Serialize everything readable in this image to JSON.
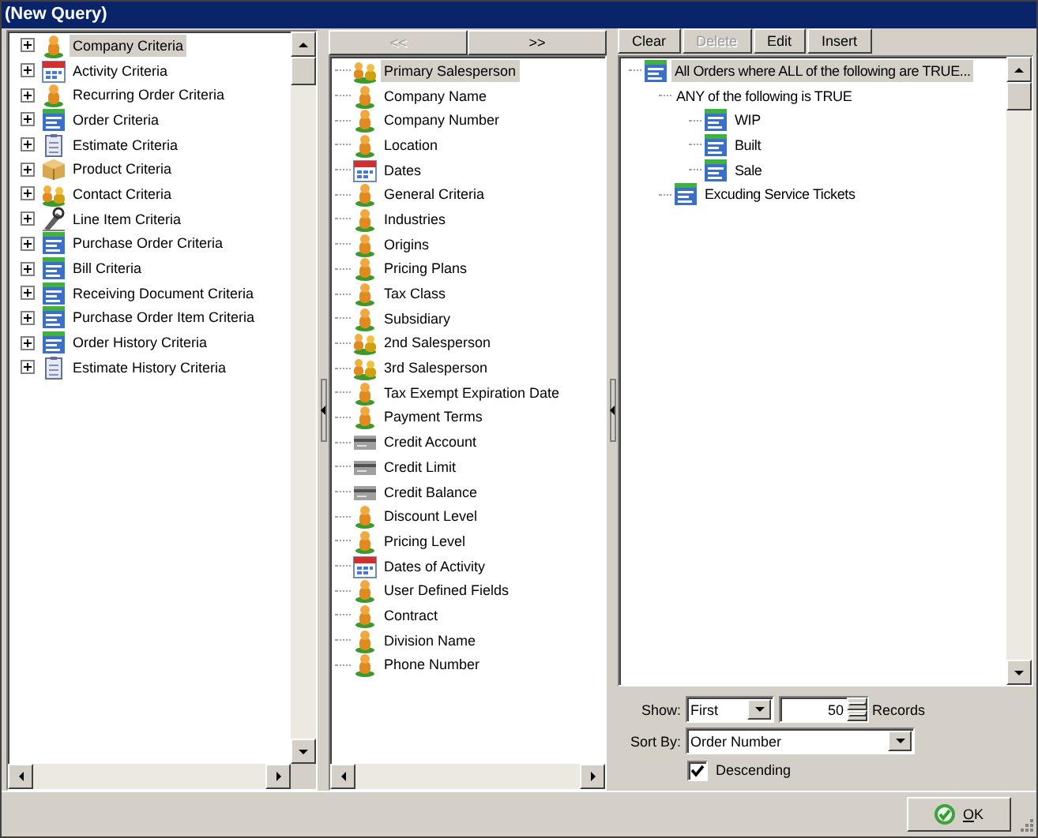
{
  "window": {
    "title": "(New Query)"
  },
  "criteria_tree": {
    "items": [
      {
        "label": "Company Criteria",
        "kind": "person",
        "expanded": false,
        "selected": true
      },
      {
        "label": "Activity Criteria",
        "kind": "calendar",
        "expanded": false,
        "selected": false
      },
      {
        "label": "Recurring Order Criteria",
        "kind": "person",
        "expanded": false,
        "selected": false
      },
      {
        "label": "Order Criteria",
        "kind": "form",
        "expanded": false,
        "selected": false
      },
      {
        "label": "Estimate Criteria",
        "kind": "clipboard",
        "expanded": false,
        "selected": false
      },
      {
        "label": "Product Criteria",
        "kind": "box",
        "expanded": false,
        "selected": false
      },
      {
        "label": "Contact Criteria",
        "kind": "people",
        "expanded": false,
        "selected": false
      },
      {
        "label": "Line Item Criteria",
        "kind": "pen",
        "expanded": false,
        "selected": false
      },
      {
        "label": "Purchase Order Criteria",
        "kind": "form",
        "expanded": false,
        "selected": false
      },
      {
        "label": "Bill Criteria",
        "kind": "form",
        "expanded": false,
        "selected": false
      },
      {
        "label": "Receiving Document Criteria",
        "kind": "form",
        "expanded": false,
        "selected": false
      },
      {
        "label": "Purchase Order Item Criteria",
        "kind": "form",
        "expanded": false,
        "selected": false
      },
      {
        "label": "Order History Criteria",
        "kind": "form",
        "expanded": false,
        "selected": false
      },
      {
        "label": "Estimate History Criteria",
        "kind": "clipboard",
        "expanded": false,
        "selected": false
      }
    ]
  },
  "field_nav": {
    "buttons": [
      {
        "label": "<<",
        "disabled": true
      },
      {
        "label": ">>",
        "disabled": false
      }
    ]
  },
  "field_tree": {
    "items": [
      {
        "label": "Primary Salesperson",
        "kind": "people",
        "selected": true
      },
      {
        "label": "Company Name",
        "kind": "person",
        "selected": false
      },
      {
        "label": "Company Number",
        "kind": "person",
        "selected": false
      },
      {
        "label": "Location",
        "kind": "person",
        "selected": false
      },
      {
        "label": "Dates",
        "kind": "calendar",
        "selected": false
      },
      {
        "label": "General Criteria",
        "kind": "person",
        "selected": false
      },
      {
        "label": "Industries",
        "kind": "person",
        "selected": false
      },
      {
        "label": "Origins",
        "kind": "person",
        "selected": false
      },
      {
        "label": "Pricing Plans",
        "kind": "person",
        "selected": false
      },
      {
        "label": "Tax Class",
        "kind": "person",
        "selected": false
      },
      {
        "label": "Subsidiary",
        "kind": "person",
        "selected": false
      },
      {
        "label": "2nd Salesperson",
        "kind": "people",
        "selected": false
      },
      {
        "label": "3rd Salesperson",
        "kind": "people",
        "selected": false
      },
      {
        "label": "Tax Exempt Expiration Date",
        "kind": "person",
        "selected": false
      },
      {
        "label": "Payment Terms",
        "kind": "person",
        "selected": false
      },
      {
        "label": "Credit Account",
        "kind": "card",
        "selected": false
      },
      {
        "label": "Credit Limit",
        "kind": "card",
        "selected": false
      },
      {
        "label": "Credit Balance",
        "kind": "card",
        "selected": false
      },
      {
        "label": "Discount Level",
        "kind": "person",
        "selected": false
      },
      {
        "label": "Pricing Level",
        "kind": "person",
        "selected": false
      },
      {
        "label": "Dates of Activity",
        "kind": "calendar",
        "selected": false
      },
      {
        "label": "User Defined Fields",
        "kind": "person",
        "selected": false
      },
      {
        "label": "Contract",
        "kind": "person",
        "selected": false
      },
      {
        "label": "Division Name",
        "kind": "person",
        "selected": false
      },
      {
        "label": "Phone Number",
        "kind": "person",
        "selected": false
      }
    ]
  },
  "query_toolbar": {
    "buttons": [
      {
        "label": "Clear",
        "disabled": false
      },
      {
        "label": "Delete",
        "disabled": true
      },
      {
        "label": "Edit",
        "disabled": false
      },
      {
        "label": "Insert",
        "disabled": false
      }
    ]
  },
  "query_tree": {
    "items": [
      {
        "label": "All Orders where ALL of the following are TRUE...",
        "kind": "form",
        "selected": true,
        "children": [
          {
            "label": "ANY of the following is TRUE",
            "kind": "group",
            "selected": false,
            "children": [
              {
                "label": "WIP",
                "kind": "form",
                "selected": false
              },
              {
                "label": "Built",
                "kind": "form",
                "selected": false
              },
              {
                "label": "Sale",
                "kind": "form",
                "selected": false
              }
            ]
          },
          {
            "label": "Excuding Service Tickets",
            "kind": "form",
            "selected": false
          }
        ]
      }
    ]
  },
  "options": {
    "show_label": "Show:",
    "show_value": "First",
    "count": "50",
    "records_label": "Records",
    "sort_label": "Sort By:",
    "sort_value": "Order Number",
    "descending": {
      "label": "Descending",
      "checked": true
    }
  },
  "ok_button": {
    "label": "OK"
  }
}
